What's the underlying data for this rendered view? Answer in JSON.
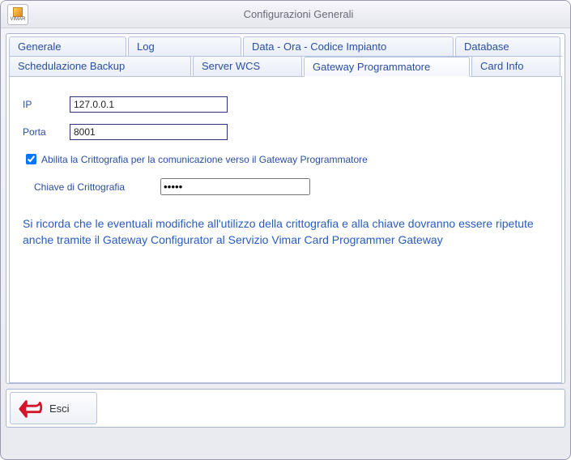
{
  "window": {
    "title": "Configurazioni Generali",
    "logo_text": "VIMAR"
  },
  "tabs_row1": {
    "generale": "Generale",
    "log": "Log",
    "data_ora": "Data - Ora - Codice Impianto",
    "database": "Database"
  },
  "tabs_row2": {
    "sched": "Schedulazione Backup",
    "server_wcs": "Server WCS",
    "gateway": "Gateway Programmatore",
    "card_info": "Card Info"
  },
  "form": {
    "ip_label": "IP",
    "ip_value": "127.0.0.1",
    "porta_label": "Porta",
    "porta_value": "8001",
    "enable_crypto_label": "Abilita la Crittografia per la comunicazione verso il Gateway Programmatore",
    "enable_crypto_checked": true,
    "key_label": "Chiave di Crittografia",
    "key_value": "•••••"
  },
  "note": "Si ricorda che le eventuali modifiche all'utilizzo della crittografia e alla chiave dovranno essere ripetute anche tramite il Gateway Configurator al Servizio Vimar Card Programmer Gateway",
  "footer": {
    "exit": "Esci"
  }
}
